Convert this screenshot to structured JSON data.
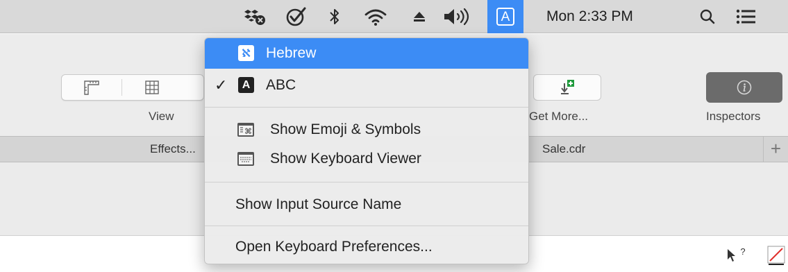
{
  "menubar": {
    "clock": "Mon 2:33 PM",
    "input_source_letter": "A",
    "icons": [
      "dropbox-sync-icon",
      "checkmark-circle-icon",
      "bluetooth-icon",
      "wifi-icon",
      "eject-icon",
      "volume-icon",
      "input-source-icon",
      "spotlight-search-icon",
      "notification-center-icon"
    ],
    "accent": "#3c8cf5"
  },
  "toolbar": {
    "view_label": "View",
    "get_more_label": "Get More...",
    "inspectors_label": "Inspectors"
  },
  "tabs": {
    "effects_label": "Effects...",
    "sale_label": "Sale.cdr",
    "add_label": "+"
  },
  "input_menu": {
    "sources": [
      {
        "badge": "ℵ",
        "label": "Hebrew",
        "checked": false,
        "highlighted": true
      },
      {
        "badge": "A",
        "label": "ABC",
        "checked": true,
        "highlighted": false
      }
    ],
    "check_mark": "✓",
    "show_emoji": "Show Emoji & Symbols",
    "show_keyboard_viewer": "Show Keyboard Viewer",
    "show_input_source_name": "Show Input Source Name",
    "open_keyboard_prefs": "Open Keyboard Preferences..."
  },
  "canvas": {
    "help_cursor_text": "?"
  }
}
